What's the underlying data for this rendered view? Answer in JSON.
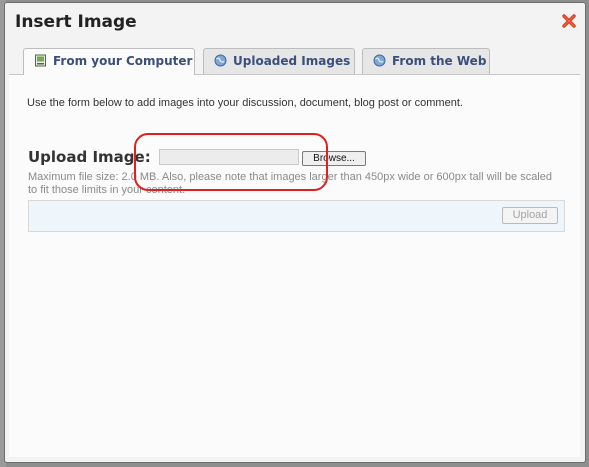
{
  "dialog": {
    "title": "Insert Image"
  },
  "tabs": [
    {
      "label": "From your Computer",
      "icon": "computer-icon",
      "active": true
    },
    {
      "label": "Uploaded Images",
      "icon": "globe-icon",
      "active": false
    },
    {
      "label": "From the Web",
      "icon": "globe-icon",
      "active": false
    }
  ],
  "form": {
    "intro": "Use the form below to add images into your discussion, document, blog post or comment.",
    "upload_label": "Upload Image:",
    "file_value": "",
    "browse_label": "Browse...",
    "note": "Maximum file size: 2.0 MB. Also, please note that images larger than 450px wide or 600px tall will be scaled to fit those limits in your content.",
    "upload_button": "Upload"
  },
  "colors": {
    "close": "#d93a1e",
    "tab_text": "#3a4f7a",
    "highlight": "#e02020"
  }
}
